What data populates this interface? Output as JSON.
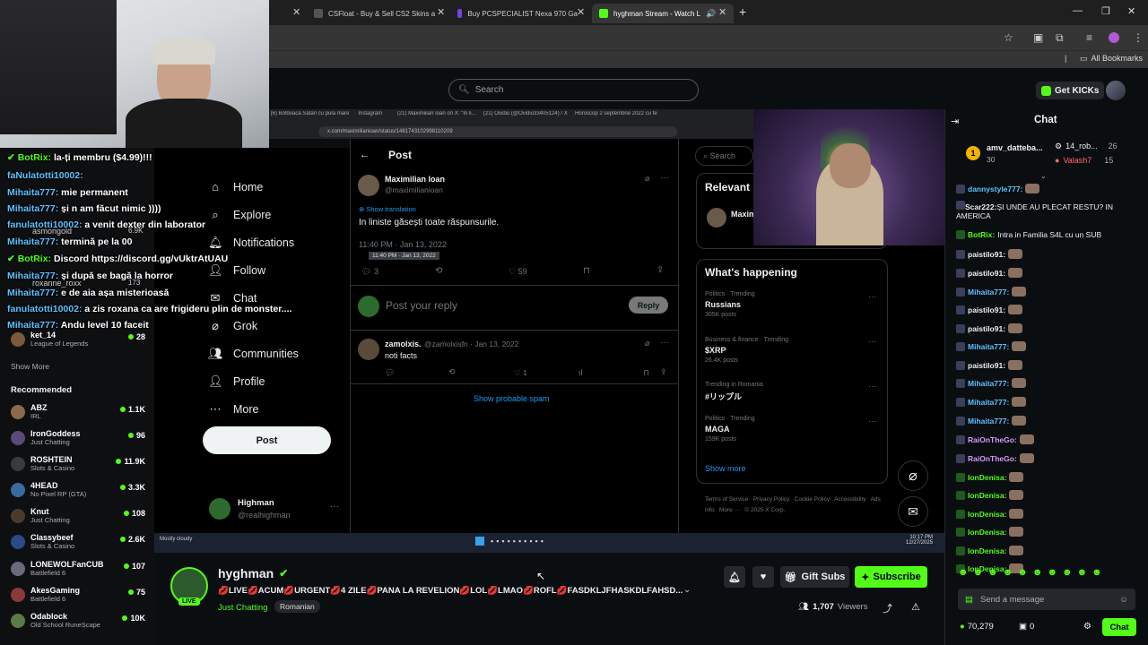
{
  "browser": {
    "tabs": [
      {
        "label": "CSFloat - Buy & Sell CS2 Skins a"
      },
      {
        "label": "Buy PCSPECIALIST Nexa 970 Ga"
      },
      {
        "label": "hyghman Stream - Watch L"
      }
    ],
    "bookmarks_label": "All Bookmarks"
  },
  "kick": {
    "search_placeholder": "Search",
    "get_kicks_label": "Get KICKs",
    "chat_title": "Chat"
  },
  "overlay_chat": [
    {
      "name": "BotRix:",
      "msg": "la-ți membru ($4.99)!!!"
    },
    {
      "name": "faNulatotti10002:",
      "msg": ""
    },
    {
      "name": "Mihaita777:",
      "msg": "mie permanent"
    },
    {
      "name": "Mihaita777:",
      "msg": "și n am făcut nimic ))))"
    },
    {
      "name": "fanulatotti10002:",
      "msg": "a venit dexter din laborator"
    },
    {
      "name": "Mihaita777:",
      "msg": "termină pe la 00"
    },
    {
      "name": "BotRix:",
      "msg": "Discord https://discord.gg/vUktrAtUAU"
    },
    {
      "name": "Mihaita777:",
      "msg": "și după se bagă la horror"
    },
    {
      "name": "Mihaita777:",
      "msg": "e de aia așa misterioasă"
    },
    {
      "name": "fanulatotti10002:",
      "msg": "a zis roxana ca are frigideru plin de monster...."
    },
    {
      "name": "Mihaita777:",
      "msg": "Andu level 10 faceit"
    }
  ],
  "following_partial": [
    {
      "name": "asmongold",
      "view": "6.9K"
    },
    {
      "name": "roxanne_roxx",
      "view": "173"
    },
    {
      "name": "ket_14",
      "cat": "League of Legends",
      "view": "28"
    }
  ],
  "show_more": "Show More",
  "recommended_title": "Recommended",
  "recommended": [
    {
      "name": "ABZ",
      "cat": "IRL",
      "view": "1.1K"
    },
    {
      "name": "IronGoddess",
      "cat": "Just Chatting",
      "view": "96"
    },
    {
      "name": "ROSHTEIN",
      "cat": "Slots & Casino",
      "view": "11.9K"
    },
    {
      "name": "4HEAD",
      "cat": "No Pixel RP (GTA)",
      "view": "3.3K"
    },
    {
      "name": "Knut",
      "cat": "Just Chatting",
      "view": "108"
    },
    {
      "name": "Classybeef",
      "cat": "Slots & Casino",
      "view": "2.6K"
    },
    {
      "name": "LONEWOLFanCUB",
      "cat": "Battlefield 6",
      "view": "107"
    },
    {
      "name": "AkesGaming",
      "cat": "Battlefield 6",
      "view": "75"
    },
    {
      "name": "Odablock",
      "cat": "Old School RuneScape",
      "view": "10K"
    }
  ],
  "xnav": [
    "Home",
    "Explore",
    "Notifications",
    "Follow",
    "Chat",
    "Grok",
    "Communities",
    "Profile",
    "More"
  ],
  "xpost_button": "Post",
  "xuser": {
    "name": "Highman",
    "handle": "@realhighman"
  },
  "tweet": {
    "header": "Post",
    "author": "Maximilian Ioan",
    "handle": "@maximilianioan",
    "show_translation": "Show translation",
    "text": "In liniste găsești toate răspunsurile.",
    "time": "11:40 PM · Jan 13, 2022",
    "replies": "3",
    "likes": "59",
    "reply_placeholder": "Post your reply",
    "reply_button": "Reply",
    "reply_author": "zamolxis.",
    "reply_handle": "@zamolxisfn · Jan 13, 2022",
    "reply_text": "noti facts",
    "reply_likes": "1",
    "spam_link": "Show probable spam",
    "url": "x.com/maximilianioan/status/1481743102998110209"
  },
  "xright": {
    "search": "Search",
    "relevant": "Relevant",
    "relevant_name": "Maxim",
    "happening": "What's happening",
    "trends": [
      {
        "cat": "Politics · Trending",
        "name": "Russians",
        "count": "305K posts"
      },
      {
        "cat": "Business & finance · Trending",
        "name": "$XRP",
        "count": "26.4K posts"
      },
      {
        "cat": "Trending in Romania",
        "name": "#リップル",
        "count": ""
      },
      {
        "cat": "Politics · Trending",
        "name": "MAGA",
        "count": "159K posts"
      }
    ],
    "show_more": "Show more",
    "footer": "Terms of Service   Privacy Policy   Cookie Policy   Accessibility   Ads info   More ···   © 2025 X Corp."
  },
  "chat_top": {
    "user1": "amv_datteba...",
    "user2": "14_rob...",
    "count2": "26",
    "user3": "Valash7",
    "count3": "15",
    "count1": "30"
  },
  "chat": [
    {
      "name": "dannystyle777:",
      "msg": "",
      "color": "#5dc1ff"
    },
    {
      "name": "Scar222:",
      "msg": "ȘI UNDE AU PLECAT RESTU? IN AMERICA",
      "color": "#efeff1"
    },
    {
      "name": "BotRix:",
      "msg": "Intra in Familia S4L cu un SUB",
      "color": "#53fc18"
    },
    {
      "name": "paistilo91:",
      "msg": "",
      "color": "#efeff1"
    },
    {
      "name": "paistilo91:",
      "msg": "",
      "color": "#efeff1"
    },
    {
      "name": "Mihaita777:",
      "msg": "",
      "color": "#5dc1ff"
    },
    {
      "name": "paistilo91:",
      "msg": "",
      "color": "#efeff1"
    },
    {
      "name": "paistilo91:",
      "msg": "",
      "color": "#efeff1"
    },
    {
      "name": "Mihaita777:",
      "msg": "",
      "color": "#5dc1ff"
    },
    {
      "name": "paistilo91:",
      "msg": "",
      "color": "#efeff1"
    },
    {
      "name": "Mihaita777:",
      "msg": "",
      "color": "#5dc1ff"
    },
    {
      "name": "Mihaita777:",
      "msg": "",
      "color": "#5dc1ff"
    },
    {
      "name": "Mihaita777:",
      "msg": "",
      "color": "#5dc1ff"
    },
    {
      "name": "RaiOnTheGo:",
      "msg": "",
      "color": "#d29bff"
    },
    {
      "name": "RaiOnTheGo:",
      "msg": "",
      "color": "#d29bff"
    },
    {
      "name": "IonDenisa:",
      "msg": "",
      "color": "#53fc18"
    },
    {
      "name": "IonDenisa:",
      "msg": "",
      "color": "#53fc18"
    },
    {
      "name": "IonDenisa:",
      "msg": "",
      "color": "#53fc18"
    },
    {
      "name": "IonDenisa:",
      "msg": "",
      "color": "#53fc18"
    },
    {
      "name": "IonDenisa:",
      "msg": "",
      "color": "#53fc18"
    },
    {
      "name": "IonDenisa:",
      "msg": "",
      "color": "#53fc18"
    }
  ],
  "send_placeholder": "Send a message",
  "kicks_balance": "70,279",
  "subs_count": "0",
  "chat_button": "Chat",
  "stream": {
    "channel": "hyghman",
    "title": "💋LIVE💋ACUM💋URGENT💋4 ZILE💋PANA LA REVELION💋LOL💋LMAO💋ROFL💋FASDKLJFHASKDLFAHSD...",
    "category": "Just Chatting",
    "tag": "Romanian",
    "live_badge": "LIVE",
    "viewers": "1,707",
    "viewers_label": "Viewers",
    "gift_subs": "Gift Subs",
    "subscribe": "Subscribe"
  },
  "taskbar": {
    "weather": "Mostly cloudy",
    "time": "10:17 PM",
    "date": "12/27/2025"
  },
  "colors": {
    "kick_green": "#53fc18",
    "bg": "#0b0e11",
    "x_blue": "#1d9bf0"
  }
}
